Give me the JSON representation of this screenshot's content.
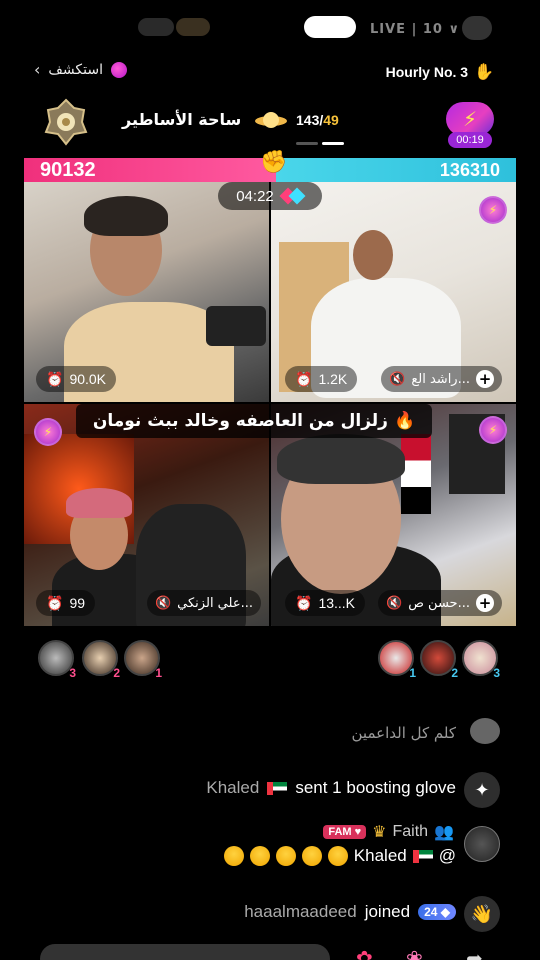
{
  "status": {
    "partial_text": "LIVE | 10 ∨"
  },
  "header": {
    "explore_label": "استكشف",
    "hourly_label": "Hourly No. 3"
  },
  "arena": {
    "title": "ساحة الأساطير",
    "count_current": "143/",
    "count_target": "49",
    "battle_timer": "00:19"
  },
  "battle": {
    "score_left": "90132",
    "score_right": "136310",
    "timer": "04:22",
    "banner": "زلزال من العاصفه وخالد ببث نومان",
    "cells": [
      {
        "stat": "90.0K"
      },
      {
        "stat": "1.2K",
        "name": "راشد الع..."
      },
      {
        "stat": "99",
        "name": "علي الزنكي..."
      },
      {
        "stat": "13...K",
        "name": "حسن ص..."
      }
    ]
  },
  "gifters": {
    "left": [
      {
        "rank": "3"
      },
      {
        "rank": "2"
      },
      {
        "rank": "1"
      }
    ],
    "right": [
      {
        "rank": "1"
      },
      {
        "rank": "2"
      },
      {
        "rank": "3"
      }
    ]
  },
  "comments": {
    "faded": "كلم كل الداعمين",
    "gift_user": "Khaled",
    "gift_text": "sent 1 boosting glove",
    "faith_name": "Faith",
    "fam_badge": "FAM",
    "mention": "Khaled",
    "joined_user": "haaalmaadeed",
    "joined_text": "joined",
    "joined_level": "24"
  },
  "colors": {
    "score_left": "#f0307c",
    "score_right": "#2ec0dc",
    "accent_gold": "#f7c23a",
    "live_purple": "#9a26d6"
  }
}
